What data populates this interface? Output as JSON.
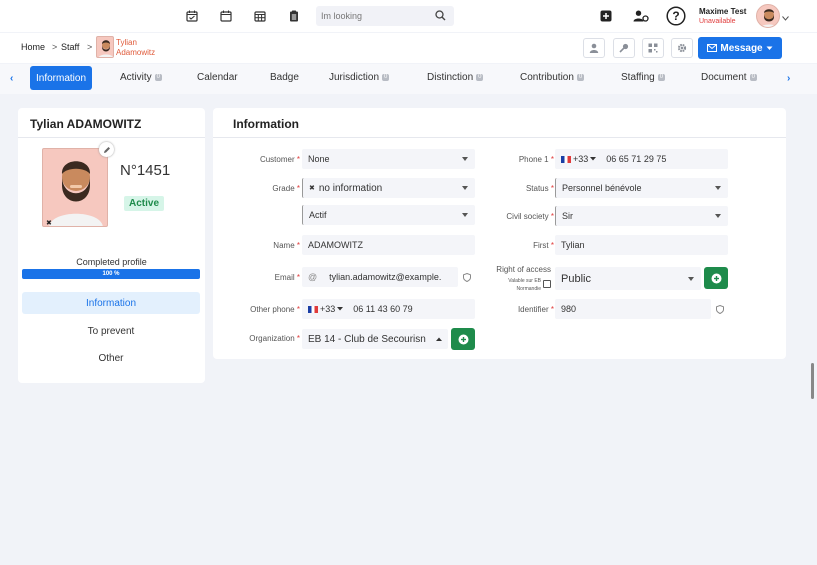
{
  "topbar": {
    "search_placeholder": "Im looking",
    "user_name": "Maxime Test",
    "user_status": "Unavailable"
  },
  "breadcrumb": {
    "home": "Home",
    "staff": "Staff",
    "person_first": "Tylian",
    "person_last": "Adamowitz",
    "message_label": "Message"
  },
  "tabs": [
    {
      "label": "Information"
    },
    {
      "label": "Activity",
      "badge": "0"
    },
    {
      "label": "Calendar"
    },
    {
      "label": "Badge"
    },
    {
      "label": "Jurisdiction",
      "badge": "0"
    },
    {
      "label": "Distinction",
      "badge": "0"
    },
    {
      "label": "Contribution",
      "badge": "0"
    },
    {
      "label": "Staffing",
      "badge": "0"
    },
    {
      "label": "Document",
      "badge": "0"
    }
  ],
  "profile": {
    "name": "Tylian ADAMOWITZ",
    "number": "N°1451",
    "status": "Active",
    "completed_label": "Completed profile",
    "completed_percent": "100 %",
    "completed_value": 100,
    "menu": [
      "Information",
      "To prevent",
      "Other"
    ]
  },
  "info": {
    "title": "Information",
    "customer_label": "Customer",
    "customer_value": "None",
    "grade_label": "Grade",
    "grade_value": "no information",
    "grade_sub_value": "Actif",
    "name_label": "Name",
    "name_value": "ADAMOWITZ",
    "email_label": "Email",
    "email_prefix": "@",
    "email_value": "tylian.adamowitz@example.",
    "other_phone_label": "Other phone",
    "other_phone_code": "+33",
    "other_phone_value": "06 11 43 60 79",
    "organization_label": "Organization",
    "organization_value": "EB 14 - Club de Secourisn",
    "phone1_label": "Phone 1",
    "phone1_code": "+33",
    "phone1_value": "06 65 71 29 75",
    "status_label": "Status",
    "status_value": "Personnel bénévole",
    "civil_label": "Civil society",
    "civil_value": "Sir",
    "first_label": "First",
    "first_value": "Tylian",
    "access_label": "Right of access",
    "access_sub1": "Valable sur EB",
    "access_sub2": "Normandie",
    "access_value": "Public",
    "identifier_label": "Identifier",
    "identifier_value": "980"
  },
  "colors": {
    "primary": "#1a73e8",
    "success": "#1e8b4b",
    "danger": "#e03b3b"
  }
}
